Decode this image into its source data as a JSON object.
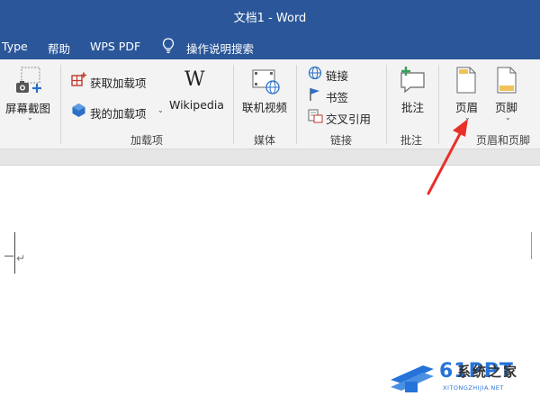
{
  "window": {
    "title": "文档1 - Word"
  },
  "menu": {
    "items": [
      "Type",
      "帮助",
      "WPS PDF"
    ],
    "tell_me": "操作说明搜索"
  },
  "ribbon": {
    "screenshot": "屏幕截图",
    "get_addins": "获取加载项",
    "my_addins": "我的加载项",
    "wikipedia": "Wikipedia",
    "addins_group": "加载项",
    "online_video": "联机视频",
    "media_group": "媒体",
    "link": "链接",
    "bookmark": "书签",
    "cross_ref": "交叉引用",
    "links_group": "链接",
    "comment": "批注",
    "comments_group": "批注",
    "header": "页眉",
    "footer": "页脚",
    "header_footer_group": "页眉和页脚"
  },
  "document": {
    "para_mark": "↵"
  },
  "watermark": {
    "brand": "61PPT",
    "name": "系统之家",
    "url": "XITONGZHIJIA.NET"
  },
  "colors": {
    "accent": "#2b579a",
    "arrow": "#e8302a",
    "watermark": "#2673d9"
  }
}
